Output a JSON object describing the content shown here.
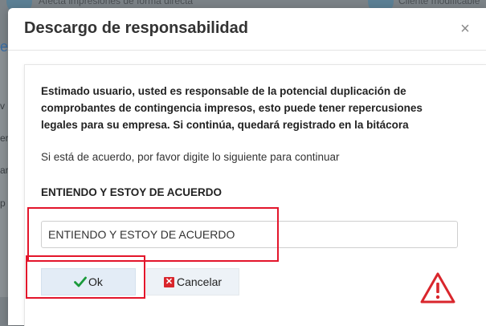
{
  "background": {
    "top_left_text": "Afecta impresiones de forma directa",
    "top_right_text": "Cliente modificable",
    "left_fragments": [
      "e",
      "v",
      "er",
      "ar",
      "p"
    ]
  },
  "dialog": {
    "title": "Descargo de responsabilidad",
    "close_label": "×"
  },
  "body": {
    "warning": "Estimado usuario, usted es responsable de la potencial duplicación de comprobantes de contingencia impresos, esto puede tener repercusiones legales para su empresa. Si continúa, quedará registrado en la bitácora",
    "instruction": "Si está de acuerdo, por favor digite lo siguiente para continuar",
    "required_phrase": "ENTIENDO Y ESTOY DE ACUERDO"
  },
  "input": {
    "value": "ENTIENDO Y ESTOY DE ACUERDO"
  },
  "buttons": {
    "ok_label": "Ok",
    "cancel_label": "Cancelar"
  },
  "colors": {
    "ok_icon": "#1a9a3a",
    "cancel_icon": "#d9262c",
    "warning_icon": "#d9262c",
    "annotation": "#e3152b"
  },
  "icons": {
    "ok": "check-icon",
    "cancel": "x-icon",
    "warning": "warning-triangle-icon",
    "close": "close-icon"
  }
}
